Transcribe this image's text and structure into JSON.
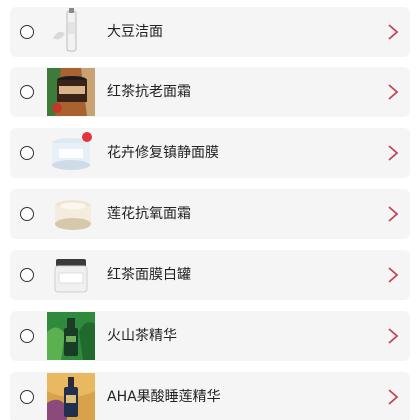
{
  "product_list": {
    "items": [
      {
        "id": "item-1",
        "name": "大豆洁面",
        "thumb_icon": "product-tube-icon"
      },
      {
        "id": "item-2",
        "name": "红茶抗老面霜",
        "thumb_icon": "cream-jar-icon"
      },
      {
        "id": "item-3",
        "name": "花卉修复镇静面膜",
        "thumb_icon": "mask-jar-icon"
      },
      {
        "id": "item-4",
        "name": "莲花抗氧面霜",
        "thumb_icon": "cream-jar-icon"
      },
      {
        "id": "item-5",
        "name": "红茶面膜白罐",
        "thumb_icon": "white-jar-icon"
      },
      {
        "id": "item-6",
        "name": "火山茶精华",
        "thumb_icon": "serum-bottle-icon"
      },
      {
        "id": "item-7",
        "name": "AHA果酸睡莲精华",
        "thumb_icon": "serum-bottle-icon"
      }
    ]
  },
  "colors": {
    "row_background": "#f5f5f5",
    "chevron": "#c1465a",
    "radio_border": "#333333",
    "label_text": "#222222"
  }
}
